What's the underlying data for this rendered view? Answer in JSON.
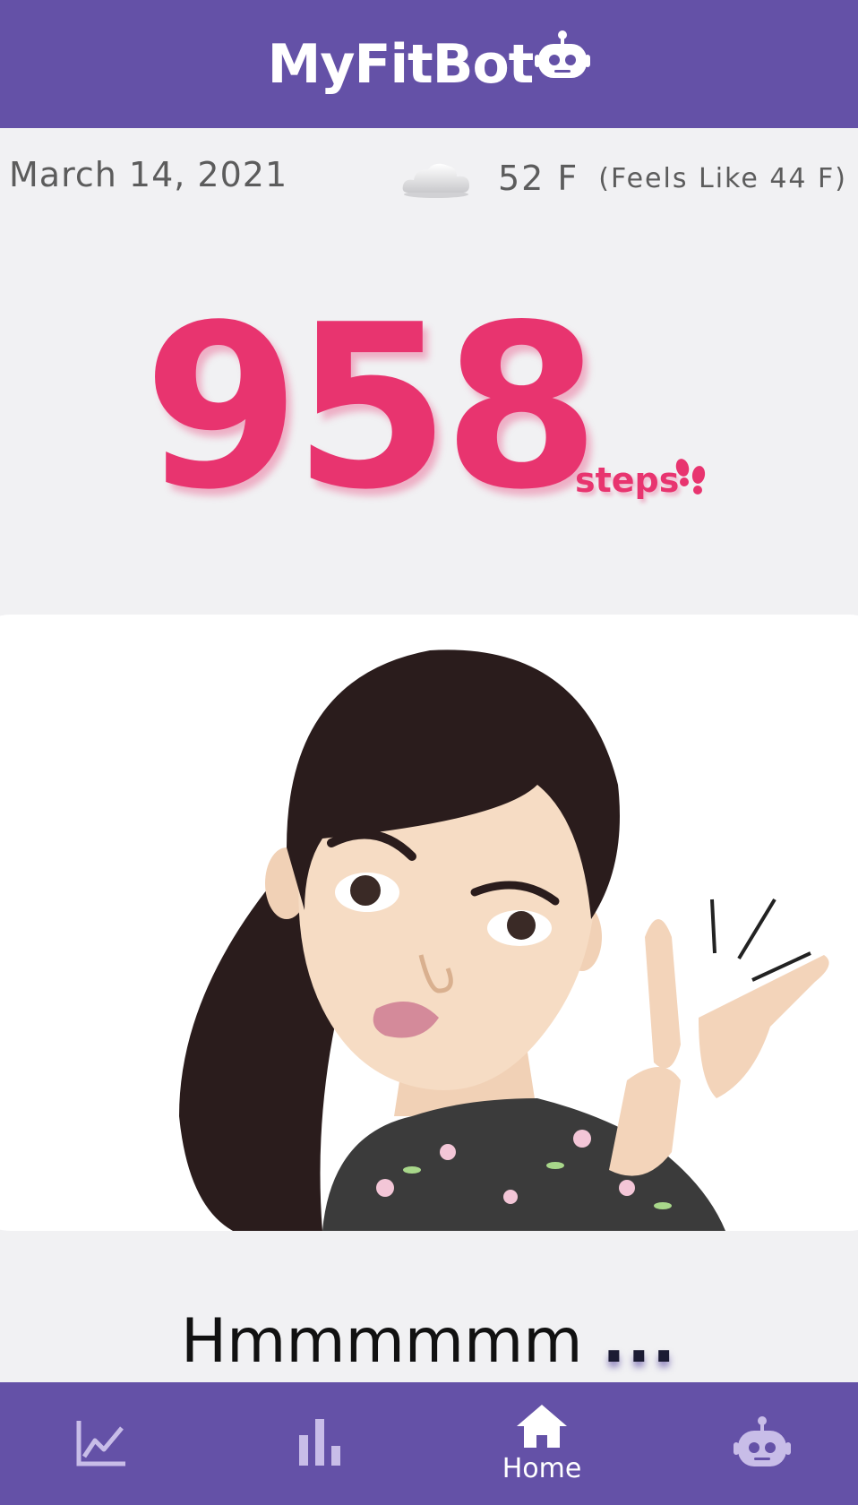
{
  "header": {
    "title": "MyFitBot",
    "logo_icon": "robot-icon"
  },
  "info": {
    "date": "March 14, 2021",
    "weather_icon": "cloud-icon",
    "temperature": "52 F",
    "feels_like": "(Feels Like 44 F)"
  },
  "steps": {
    "count": "958",
    "label": "steps",
    "icon": "footprints-icon"
  },
  "avatar": {
    "description_icon": "avatar-illustration"
  },
  "message": {
    "text": "Hmmmmmm",
    "dots": "..."
  },
  "nav": {
    "items": [
      {
        "icon": "line-chart-icon",
        "label": ""
      },
      {
        "icon": "bar-chart-icon",
        "label": ""
      },
      {
        "icon": "home-icon",
        "label": "Home"
      },
      {
        "icon": "robot-icon",
        "label": ""
      }
    ]
  },
  "colors": {
    "primary": "#6451a7",
    "accent": "#e8346f",
    "background": "#f1f1f3"
  }
}
